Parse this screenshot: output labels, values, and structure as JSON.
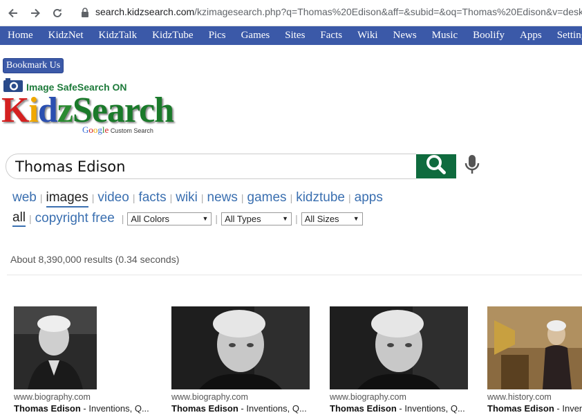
{
  "browser": {
    "url_domain": "search.kidzsearch.com",
    "url_path": "/kzimagesearch.php?q=Thomas%20Edison&aff=&subid=&oq=Thomas%20Edison&v=deskt"
  },
  "topnav": [
    "Home",
    "KidzNet",
    "KidzTalk",
    "KidzTube",
    "Pics",
    "Games",
    "Sites",
    "Facts",
    "Wiki",
    "News",
    "Music",
    "Boolify",
    "Apps",
    "Settings"
  ],
  "bookmark_label": "Bookmark Us",
  "safesearch_label": "Image SafeSearch ON",
  "logo": {
    "k": "K",
    "i": "i",
    "d": "d",
    "z": "z",
    "rest": "Search",
    "google": "Google",
    "custom": "Custom Search"
  },
  "search": {
    "value": "Thomas Edison"
  },
  "tabs": [
    "web",
    "images",
    "video",
    "facts",
    "wiki",
    "news",
    "games",
    "kidztube",
    "apps"
  ],
  "filters": {
    "all": "all",
    "copyright": "copyright free",
    "colors": "All Colors",
    "types": "All Types",
    "sizes": "All Sizes"
  },
  "results_text": "About 8,390,000 results (0.34 seconds)",
  "images": [
    {
      "site": "www.biography.com",
      "title_bold": "Thomas Edison",
      "title_rest": " - Inventions, Q..."
    },
    {
      "site": "www.biography.com",
      "title_bold": "Thomas Edison",
      "title_rest": " - Inventions, Q..."
    },
    {
      "site": "www.biography.com",
      "title_bold": "Thomas Edison",
      "title_rest": " - Inventions, Q..."
    },
    {
      "site": "www.history.com",
      "title_bold": "Thomas Edison",
      "title_rest": " - Inven"
    }
  ]
}
